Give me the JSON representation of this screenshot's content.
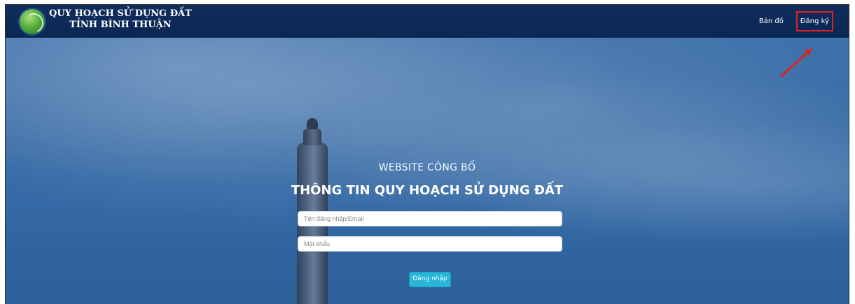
{
  "header": {
    "title_line1": "QUY HOẠCH SỬ DỤNG ĐẤT",
    "title_line2": "TỈNH BÌNH THUẬN",
    "nav": [
      {
        "label": "Bản đồ"
      },
      {
        "label": "Đăng ký"
      }
    ]
  },
  "hero": {
    "subtitle": "WEBSITE CÔNG BỐ",
    "headline": "THÔNG TIN QUY HOẠCH SỬ DỤNG ĐẤT",
    "login": {
      "username_placeholder": "Tên đăng nhập/Email",
      "password_placeholder": "Mật khẩu",
      "submit_label": "Đăng nhập"
    }
  },
  "colors": {
    "header_bg": "#0b2753",
    "button_bg": "#26b6d7",
    "highlight": "#e02020"
  }
}
